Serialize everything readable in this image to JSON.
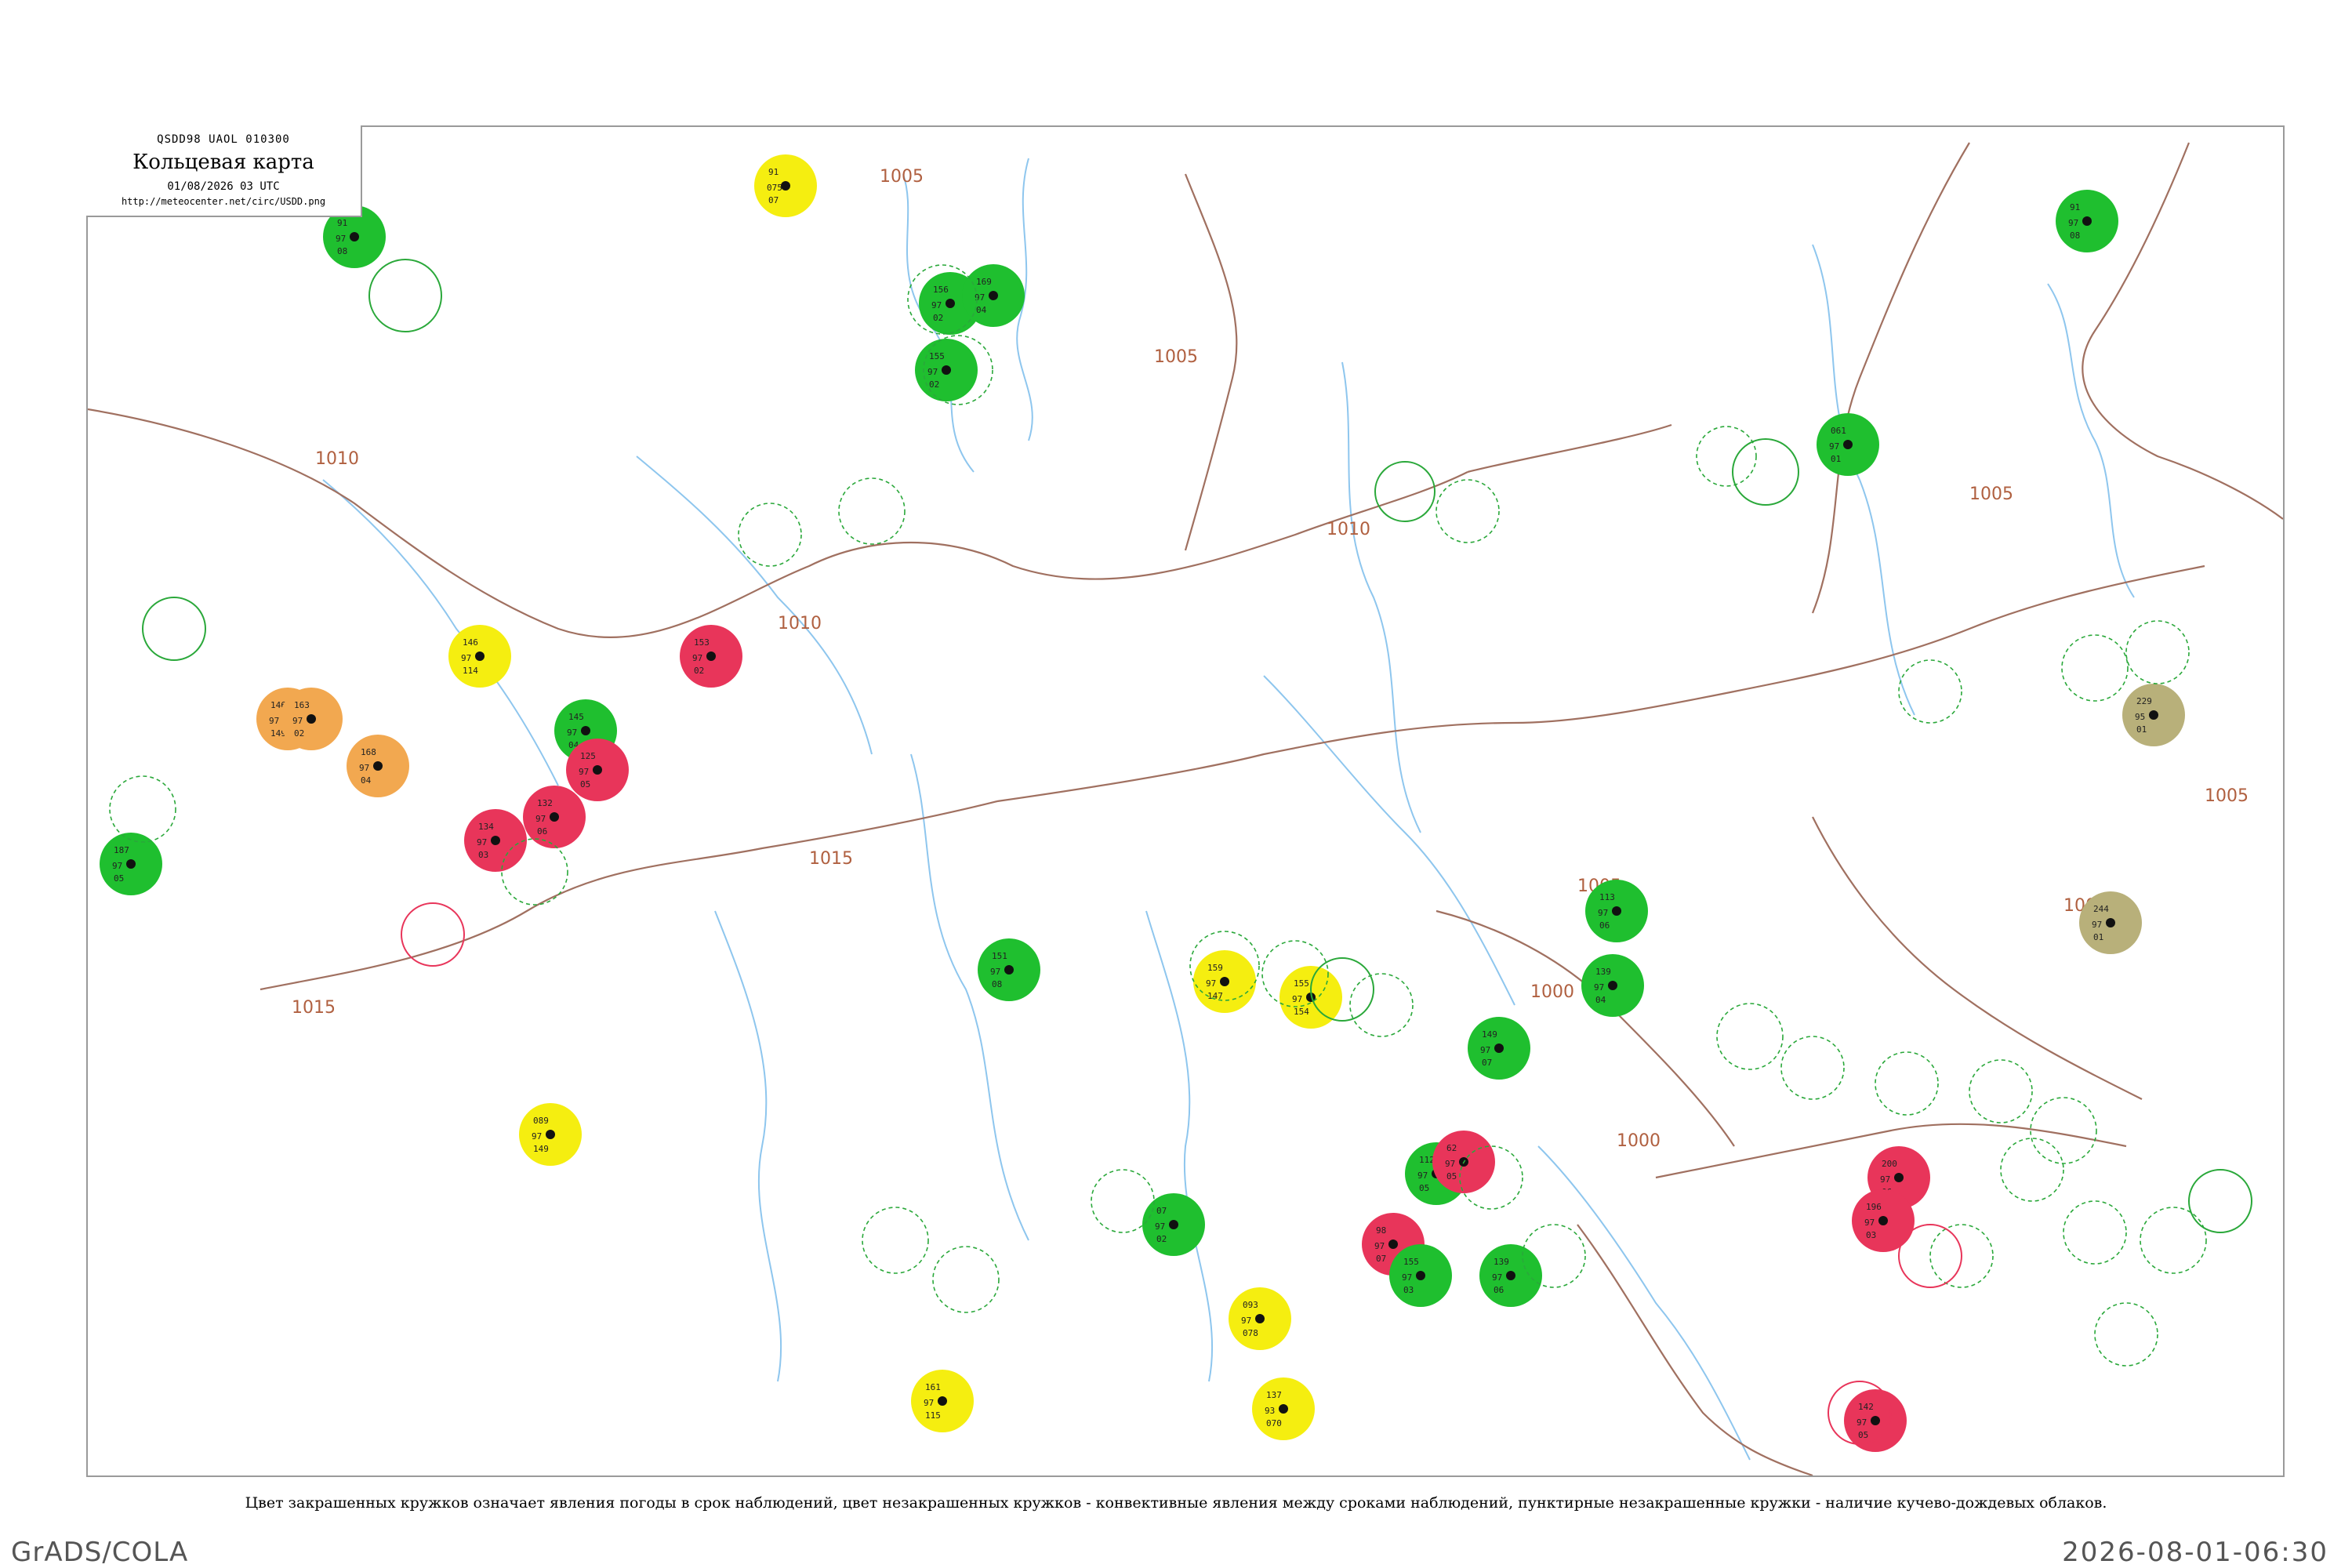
{
  "header": {
    "code": "QSDD98  UAOL  010300",
    "title": "Кольцевая карта",
    "date": "01/08/2026 03 UTC",
    "url": "http://meteocenter.net/circ/USDD.png"
  },
  "caption": "Цвет закрашенных кружков означает явления погоды в срок наблюдений, цвет незакрашенных кружков - конвективные явления между сроками наблюдений, пунктирные незакрашенные кружки - наличие кучево-дождевых облаков.",
  "footer": {
    "left": "GrADS/COLA",
    "right": "2026-08-01-06:30"
  },
  "colors": {
    "green": "#1fbf2f",
    "yellow": "#f5ee10",
    "pale_yellow": "#fbf38a",
    "red": "#e8355a",
    "orange": "#f2a850",
    "olive": "#b8b07a",
    "isobar": "#a07060",
    "river": "#8ec6ee",
    "dash_green": "#2aa83a"
  },
  "isobar_labels": [
    "1005",
    "1005",
    "1010",
    "1010",
    "1010",
    "1015",
    "1015",
    "1005",
    "1005",
    "1005",
    "1000",
    "1000",
    "1005"
  ],
  "stations": [
    {
      "type": "filled",
      "color": "green",
      "v": [
        "91",
        "97",
        "08"
      ]
    },
    {
      "type": "filled",
      "color": "yellow",
      "v": [
        "91",
        "075",
        "07"
      ]
    },
    {
      "type": "filled",
      "color": "green",
      "v": [
        "91",
        "97",
        "08"
      ]
    },
    {
      "type": "filled",
      "color": "green",
      "v": [
        "156",
        "97",
        "02"
      ]
    },
    {
      "type": "filled",
      "color": "green",
      "v": [
        "169",
        "97",
        "04"
      ]
    },
    {
      "type": "filled",
      "color": "green",
      "v": [
        "155",
        "97",
        "02"
      ]
    },
    {
      "type": "filled",
      "color": "green",
      "v": [
        "061",
        "97",
        "01"
      ]
    },
    {
      "type": "filled",
      "color": "red",
      "v": [
        "153",
        "97",
        "02"
      ]
    },
    {
      "type": "filled",
      "color": "green",
      "v": [
        "145",
        "97",
        "04"
      ]
    },
    {
      "type": "filled",
      "color": "red",
      "v": [
        "132",
        "97",
        "06"
      ]
    },
    {
      "type": "filled",
      "color": "red",
      "v": [
        "125",
        "97",
        "05"
      ]
    },
    {
      "type": "filled",
      "color": "red",
      "v": [
        "134",
        "97",
        "03"
      ]
    },
    {
      "type": "filled",
      "color": "orange",
      "v": [
        "146",
        "97",
        "149"
      ]
    },
    {
      "type": "filled",
      "color": "orange",
      "v": [
        "163",
        "97",
        "02"
      ]
    },
    {
      "type": "filled",
      "color": "orange",
      "v": [
        "168",
        "97",
        "04"
      ]
    },
    {
      "type": "filled",
      "color": "green",
      "v": [
        "187",
        "97",
        "05"
      ]
    },
    {
      "type": "filled",
      "color": "yellow",
      "v": [
        "146",
        "97",
        "114"
      ]
    },
    {
      "type": "filled",
      "color": "yellow",
      "v": [
        "089",
        "97",
        "149"
      ]
    },
    {
      "type": "filled",
      "color": "yellow",
      "v": [
        "159",
        "97",
        "147"
      ]
    },
    {
      "type": "filled",
      "color": "yellow",
      "v": [
        "155",
        "97",
        "154"
      ]
    },
    {
      "type": "filled",
      "color": "green",
      "v": [
        "151",
        "97",
        "08"
      ]
    },
    {
      "type": "filled",
      "color": "green",
      "v": [
        "113",
        "97",
        "06"
      ]
    },
    {
      "type": "filled",
      "color": "green",
      "v": [
        "139",
        "97",
        "04"
      ]
    },
    {
      "type": "filled",
      "color": "green",
      "v": [
        "149",
        "97",
        "07"
      ]
    },
    {
      "type": "filled",
      "color": "green",
      "v": [
        "112",
        "97",
        "05"
      ]
    },
    {
      "type": "filled",
      "color": "red",
      "v": [
        "62",
        "97",
        "05"
      ]
    },
    {
      "type": "filled",
      "color": "red",
      "v": [
        "98",
        "97",
        "07"
      ]
    },
    {
      "type": "filled",
      "color": "green",
      "v": [
        "155",
        "97",
        "03"
      ]
    },
    {
      "type": "filled",
      "color": "red",
      "v": [
        "200",
        "97",
        "06"
      ]
    },
    {
      "type": "filled",
      "color": "red",
      "v": [
        "196",
        "97",
        "03"
      ]
    },
    {
      "type": "filled",
      "color": "red",
      "v": [
        "142",
        "97",
        "05"
      ]
    },
    {
      "type": "filled",
      "color": "olive",
      "v": [
        "229",
        "95",
        "01"
      ]
    },
    {
      "type": "filled",
      "color": "olive",
      "v": [
        "244",
        "97",
        "01"
      ]
    },
    {
      "type": "filled",
      "color": "green",
      "v": [
        "07",
        "97",
        "02"
      ]
    },
    {
      "type": "filled",
      "color": "yellow",
      "v": [
        "093",
        "97",
        "078"
      ]
    },
    {
      "type": "filled",
      "color": "yellow",
      "v": [
        "137",
        "93",
        "070"
      ]
    },
    {
      "type": "filled",
      "color": "yellow",
      "v": [
        "161",
        "97",
        "115"
      ]
    },
    {
      "type": "filled",
      "color": "green",
      "v": [
        "139",
        "97",
        "06"
      ]
    }
  ]
}
